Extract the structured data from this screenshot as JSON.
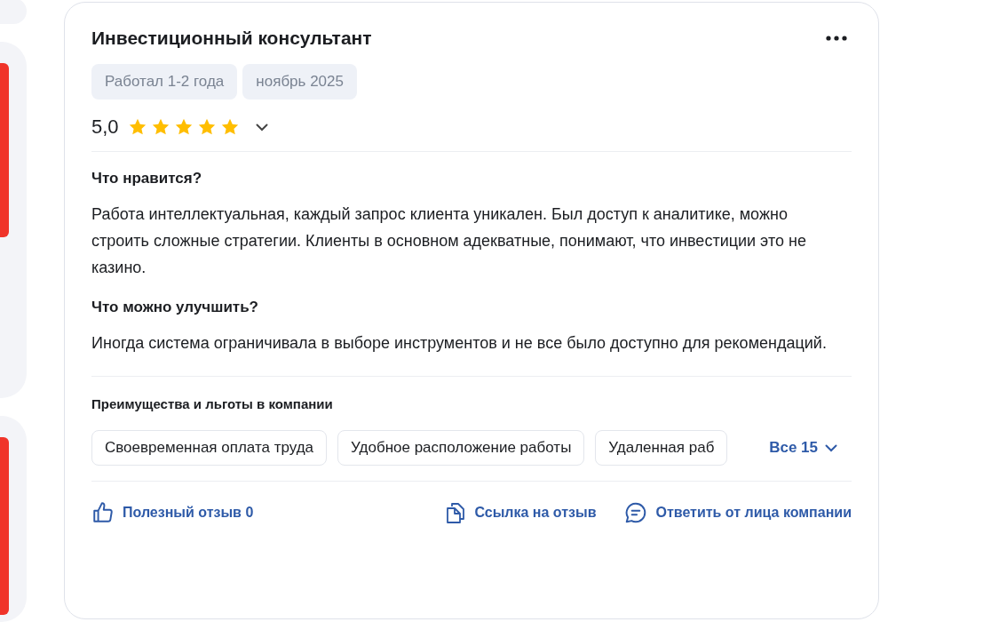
{
  "review": {
    "title": "Инвестиционный консультант",
    "tags": [
      "Работал 1-2 года",
      "ноябрь 2025"
    ],
    "rating": {
      "value": "5,0",
      "stars": 5
    },
    "sections": [
      {
        "heading": "Что нравится?",
        "text": "Работа интеллектуальная, каждый запрос клиента уникален. Был доступ к аналитике, можно строить сложные стратегии. Клиенты в основном адекватные, понимают, что инвестиции это не казино."
      },
      {
        "heading": "Что можно улучшить?",
        "text": "Иногда система ограничивала в выборе инструментов и не все было доступно для рекомендаций."
      }
    ],
    "benefits": {
      "heading": "Преимущества и льготы в компании",
      "items": [
        "Своевременная оплата труда",
        "Удобное расположение работы",
        "Удаленная раб"
      ],
      "more": "Все 15"
    },
    "actions": [
      {
        "kind": "like",
        "label": "Полезный отзыв 0"
      },
      {
        "kind": "link",
        "label": "Ссылка на отзыв"
      },
      {
        "kind": "reply",
        "label": "Ответить от лица компании"
      }
    ]
  }
}
